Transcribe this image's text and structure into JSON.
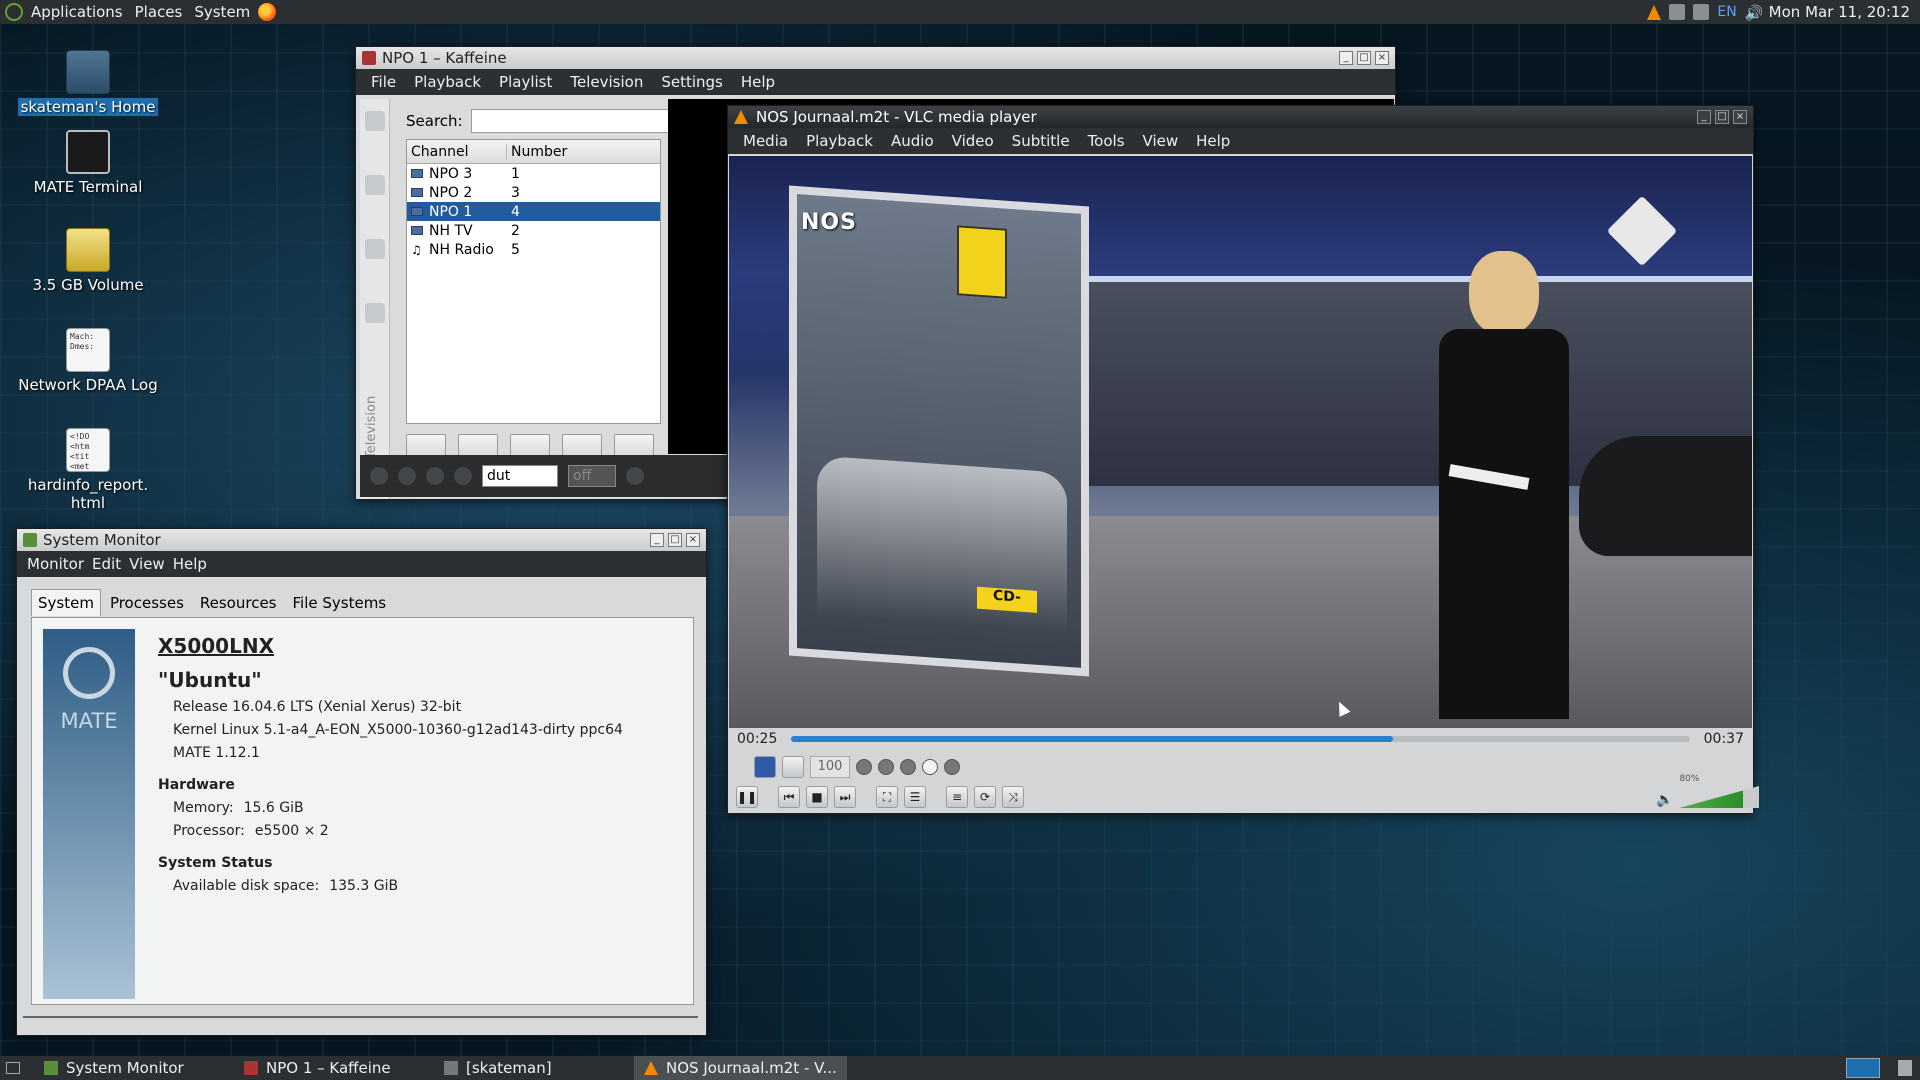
{
  "top_panel": {
    "menus": [
      "Applications",
      "Places",
      "System"
    ],
    "lang": "EN",
    "clock": "Mon Mar 11, 20:12"
  },
  "desktop_icons": [
    {
      "label": "skateman's Home",
      "icon": "home-folder-icon"
    },
    {
      "label": "MATE Terminal",
      "icon": "terminal-icon"
    },
    {
      "label": "3.5 GB Volume",
      "icon": "drive-icon"
    },
    {
      "label": "Network DPAA Log",
      "icon": "text-file-icon",
      "preview": "Mach:\nDmes:"
    },
    {
      "label": "hardinfo_report.\nhtml",
      "icon": "html-file-icon",
      "preview": "<!DO\n<htm\n<tit\n<met"
    }
  ],
  "kaffeine": {
    "title": "NPO 1 – Kaffeine",
    "menu": [
      "File",
      "Playback",
      "Playlist",
      "Television",
      "Settings",
      "Help"
    ],
    "search_label": "Search:",
    "search_value": "",
    "columns": [
      "Channel",
      "Number"
    ],
    "channels": [
      {
        "name": "NPO 3",
        "number": "1",
        "type": "tv"
      },
      {
        "name": "NPO 2",
        "number": "3",
        "type": "tv"
      },
      {
        "name": "NPO 1",
        "number": "4",
        "type": "tv",
        "selected": true
      },
      {
        "name": "NH TV",
        "number": "2",
        "type": "tv"
      },
      {
        "name": "NH Radio",
        "number": "5",
        "type": "radio"
      }
    ],
    "side_label": "Television",
    "audio_lang": "dut",
    "subtitle": "off"
  },
  "sysmon": {
    "title": "System Monitor",
    "menu": [
      "Monitor",
      "Edit",
      "View",
      "Help"
    ],
    "tabs": [
      "System",
      "Processes",
      "Resources",
      "File Systems"
    ],
    "logo_text": "MATE",
    "hostname": "X5000LNX",
    "distro": "\"Ubuntu\"",
    "release": "Release 16.04.6 LTS (Xenial Xerus) 32-bit",
    "kernel": "Kernel Linux 5.1-a4_A-EON_X5000-10360-g12ad143-dirty ppc64",
    "mate": "MATE 1.12.1",
    "hardware_label": "Hardware",
    "memory_label": "Memory:",
    "memory": "15.6 GiB",
    "processor_label": "Processor:",
    "processor": "e5500 × 2",
    "status_label": "System Status",
    "disk_label": "Available disk space:",
    "disk": "135.3 GiB"
  },
  "vlc": {
    "title": "NOS Journaal.m2t - VLC media player",
    "menu": [
      "Media",
      "Playback",
      "Audio",
      "Video",
      "Subtitle",
      "Tools",
      "View",
      "Help"
    ],
    "video_logo": "NOS",
    "plate_text": "CD-",
    "elapsed": "00:25",
    "total": "00:37",
    "progress": 0.67,
    "speed": "100",
    "volume_percent_label": "80%",
    "volume": 0.8
  },
  "taskbar": {
    "tasks": [
      {
        "label": "System Monitor",
        "active": false
      },
      {
        "label": "NPO 1 – Kaffeine",
        "active": false
      },
      {
        "label": "[skateman]",
        "active": false
      },
      {
        "label": "NOS Journaal.m2t - V...",
        "active": true
      }
    ]
  }
}
